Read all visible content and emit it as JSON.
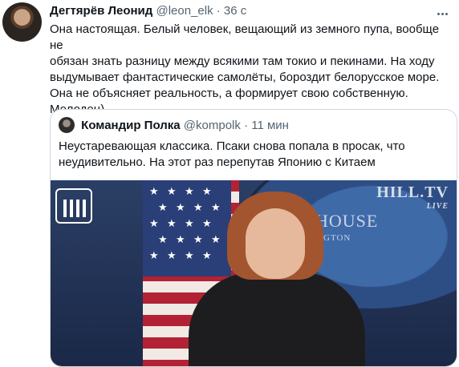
{
  "tweet": {
    "author_name": "Дегтярёв Леонид",
    "handle": "@leon_elk",
    "separator": "·",
    "time": "36 с",
    "text": "Она настоящая. Белый человек, вещающий из земного пупа, вообще не\nобязан знать разницу между всякими там токио и пекинами. На ходу\nвыдумывает фантастические самолёты, бороздит белорусское море.\nОна не объясняет реальность, а формирует свою собственную.\nМолодец)"
  },
  "quoted_tweet": {
    "author_name": "Командир Полка",
    "handle": "@kompolk",
    "separator": "·",
    "time": "11 мин",
    "text": "Неустаревающая классика. Псаки снова попала в просак, что\nнеудивительно. На этот раз перепутав Японию с Китаем"
  },
  "media": {
    "watermark_main": "HILL.TV",
    "watermark_sub": "LIVE",
    "background_text": "HOUSE",
    "background_text_2": "GTON"
  },
  "icons": {
    "more": "more-horizontal-icon",
    "logo": "network-logo-icon"
  },
  "colors": {
    "text": "#0f1419",
    "secondary": "#536471",
    "border": "#cfd9de"
  }
}
